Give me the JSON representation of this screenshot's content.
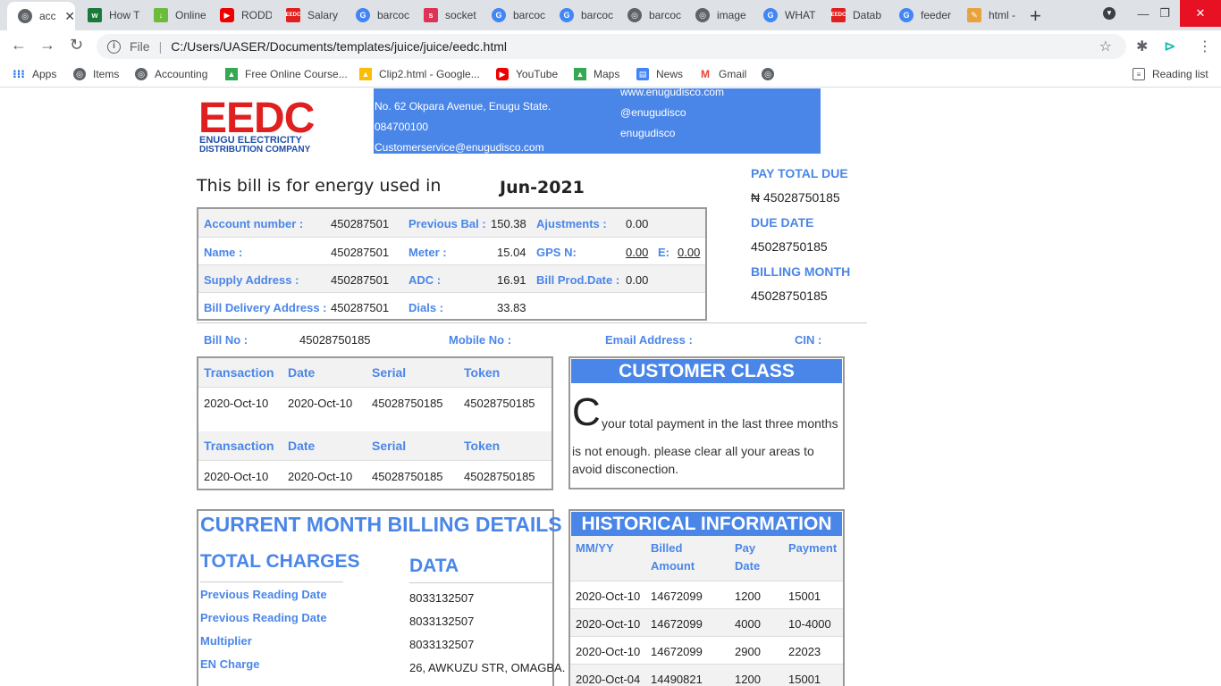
{
  "browser": {
    "tabs": [
      {
        "title": "acc",
        "icon": "globe-icon",
        "active": true
      },
      {
        "title": "How T",
        "icon": "wikihow-icon"
      },
      {
        "title": "Online",
        "icon": "download-icon"
      },
      {
        "title": "RODD",
        "icon": "youtube-icon"
      },
      {
        "title": "Salary",
        "icon": "eedc-icon"
      },
      {
        "title": "barcoc",
        "icon": "google-icon"
      },
      {
        "title": "socket",
        "icon": "socket-icon"
      },
      {
        "title": "barcoc",
        "icon": "google-icon"
      },
      {
        "title": "barcoc",
        "icon": "google-icon"
      },
      {
        "title": "barcoc",
        "icon": "globe-icon"
      },
      {
        "title": "image",
        "icon": "globe-icon"
      },
      {
        "title": "WHAT",
        "icon": "google-icon"
      },
      {
        "title": "Datab",
        "icon": "eedc-icon"
      },
      {
        "title": "feeder",
        "icon": "google-icon"
      },
      {
        "title": "html -",
        "icon": "html-icon"
      }
    ],
    "address": {
      "scheme_label": "File",
      "url": "C:/Users/UASER/Documents/templates/juice/juice/eedc.html"
    },
    "bookmarks": [
      {
        "label": "Apps"
      },
      {
        "label": "Items"
      },
      {
        "label": "Accounting"
      },
      {
        "label": "Free Online Course..."
      },
      {
        "label": "Clip2.html - Google..."
      },
      {
        "label": "YouTube"
      },
      {
        "label": "Maps"
      },
      {
        "label": "News"
      },
      {
        "label": "Gmail"
      }
    ],
    "reading_list": "Reading list"
  },
  "header": {
    "logo_big": "EEDC",
    "logo_line1": "ENUGU ELECTRICITY",
    "logo_line2": "DISTRIBUTION COMPANY",
    "address": "No. 62 Okpara Avenue, Enugu State.",
    "phone": "084700100",
    "email": "Customerservice@enugudisco.com",
    "website": "www.enugudisco.com",
    "twitter": "@enugudisco",
    "facebook": "enugudisco"
  },
  "bill_period": {
    "label": "This bill is for energy used in",
    "value": "Jun-2021"
  },
  "summary": {
    "pay_total_label": "PAY TOTAL DUE",
    "pay_total_value": "₦ 45028750185",
    "due_date_label": "DUE DATE",
    "due_date_value": "45028750185",
    "billing_month_label": "BILLING MONTH",
    "billing_month_value": "45028750185"
  },
  "account": {
    "rows": [
      {
        "l1": "Account number :",
        "v1": "450287501",
        "l2": "Previous Bal :",
        "v2": "150.38",
        "l3": "Ajustments :",
        "v3": "0.00"
      },
      {
        "l1": "Name :",
        "v1": "450287501",
        "l2": "Meter :",
        "v2": "15.04",
        "l3": "GPS N:",
        "v3": "0.00",
        "l4": "E:",
        "v4": "0.00"
      },
      {
        "l1": "Supply Address :",
        "v1": "450287501",
        "l2": "ADC :",
        "v2": "16.91",
        "l3": "Bill Prod.Date :",
        "v3": "0.00"
      },
      {
        "l1": "Bill Delivery Address :",
        "v1": "450287501",
        "l2": "Dials :",
        "v2": "33.83"
      }
    ]
  },
  "bill_info": {
    "bill_no_label": "Bill No :",
    "bill_no_value": "45028750185",
    "mobile_label": "Mobile No :",
    "email_label": "Email Address :",
    "cin_label": "CIN :"
  },
  "transactions": {
    "headers": [
      "Transaction",
      "Date",
      "Serial",
      "Token"
    ],
    "rows": [
      [
        "2020-Oct-10",
        "2020-Oct-10",
        "45028750185",
        "45028750185"
      ],
      [
        "2020-Oct-10",
        "2020-Oct-10",
        "45028750185",
        "45028750185"
      ]
    ]
  },
  "customer_class": {
    "title": "CUSTOMER CLASS",
    "letter": "C",
    "line1": "your total payment in the last three months",
    "line2": "is not enough. please clear all your areas to",
    "line3": "avoid disconection."
  },
  "billing": {
    "title": "CURRENT MONTH BILLING DETAILS",
    "charges_title": "TOTAL CHARGES",
    "data_title": "DATA",
    "rows": [
      {
        "label": "Previous Reading Date",
        "value": "8033132507"
      },
      {
        "label": "Previous Reading Date",
        "value": "8033132507"
      },
      {
        "label": "Multiplier",
        "value": "8033132507"
      },
      {
        "label": "EN Charge",
        "value": "26, AWKUZU STR, OMAGBA."
      }
    ]
  },
  "historical": {
    "title": "HISTORICAL INFORMATION",
    "headers": [
      "MM/YY",
      "Billed",
      "Amount",
      "Pay",
      "Date",
      "Payment"
    ],
    "rows": [
      [
        "2020-Oct-10",
        "14672099",
        "1200",
        "15001"
      ],
      [
        "2020-Oct-10",
        "14672099",
        "4000",
        "10-4000"
      ],
      [
        "2020-Oct-10",
        "14672099",
        "2900",
        "22023"
      ],
      [
        "2020-Oct-04",
        "14490821",
        "1200",
        "15001"
      ]
    ]
  },
  "colors": {
    "accent": "#4a86e8",
    "brand_red": "#e02020",
    "brand_navy": "#1f4ea8"
  }
}
